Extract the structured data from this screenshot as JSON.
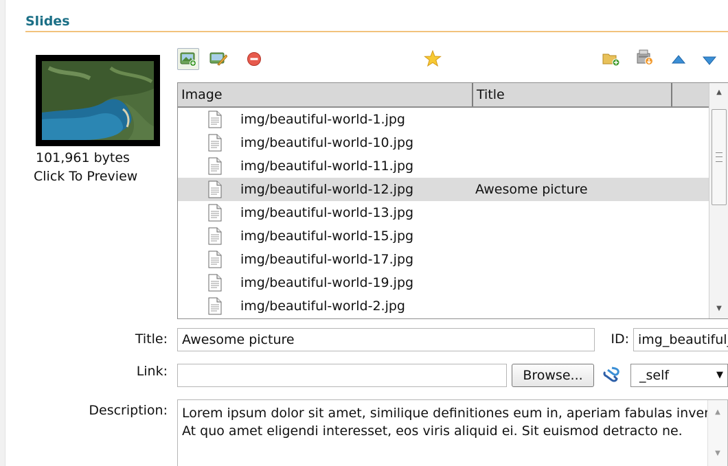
{
  "section": {
    "title": "Slides"
  },
  "thumbnail": {
    "size_text": "101,961 bytes",
    "preview_text": "Click To Preview"
  },
  "toolbar": {
    "buttons": [
      {
        "name": "add-image-button",
        "icon": "add-image-icon"
      },
      {
        "name": "edit-image-button",
        "icon": "edit-image-icon"
      },
      {
        "name": "remove-button",
        "icon": "remove-icon"
      },
      {
        "name": "default-star-button",
        "icon": "star-icon"
      },
      {
        "name": "add-folder-button",
        "icon": "add-folder-icon"
      },
      {
        "name": "import-button",
        "icon": "import-icon"
      },
      {
        "name": "move-up-button",
        "icon": "triangle-up-icon"
      },
      {
        "name": "move-down-button",
        "icon": "triangle-down-icon"
      }
    ]
  },
  "grid": {
    "columns": [
      "Image",
      "Title"
    ],
    "rows": [
      {
        "image": "img/beautiful-world-1.jpg",
        "title": ""
      },
      {
        "image": "img/beautiful-world-10.jpg",
        "title": ""
      },
      {
        "image": "img/beautiful-world-11.jpg",
        "title": ""
      },
      {
        "image": "img/beautiful-world-12.jpg",
        "title": "Awesome picture",
        "selected": true
      },
      {
        "image": "img/beautiful-world-13.jpg",
        "title": ""
      },
      {
        "image": "img/beautiful-world-15.jpg",
        "title": ""
      },
      {
        "image": "img/beautiful-world-17.jpg",
        "title": ""
      },
      {
        "image": "img/beautiful-world-19.jpg",
        "title": ""
      },
      {
        "image": "img/beautiful-world-2.jpg",
        "title": ""
      }
    ]
  },
  "form": {
    "title_label": "Title:",
    "title_value": "Awesome picture",
    "id_label": "ID:",
    "id_value": "img_beautiful_",
    "link_label": "Link:",
    "link_value": "",
    "browse_label": "Browse...",
    "target_value": "_self",
    "description_label": "Description:",
    "description_value": "Lorem ipsum dolor sit amet, similique definitiones eum in, aperiam fabulas inveni\nAt quo amet eligendi interesset, eos viris aliquid ei. Sit euismod detracto ne."
  },
  "colors": {
    "accent": "#1b6f86",
    "rule": "#f2c27c",
    "selected_row": "#dcdcdc"
  }
}
